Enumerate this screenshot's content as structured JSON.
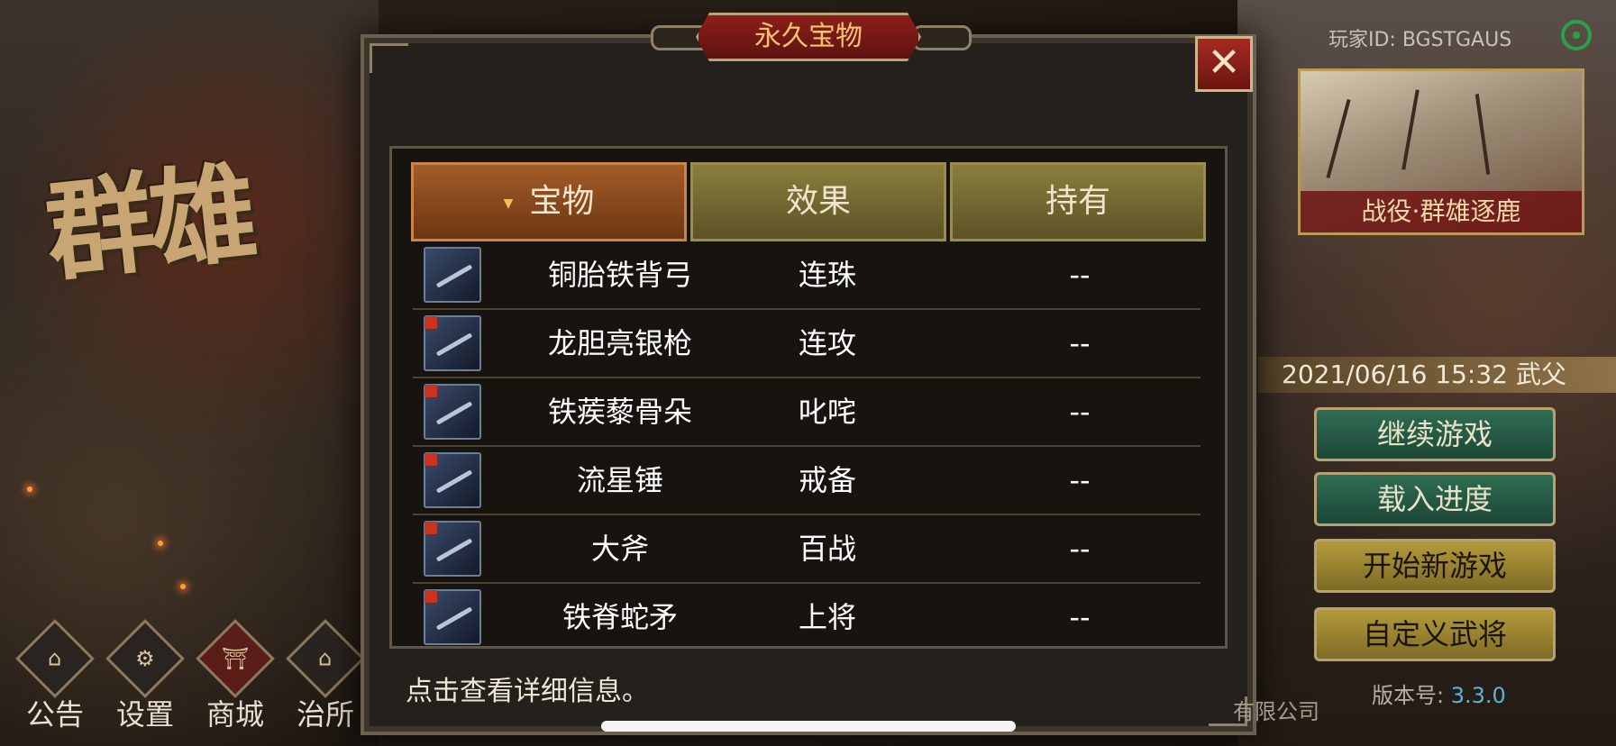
{
  "background": {
    "game_logo": "群雄",
    "player_id_label": "玩家ID:",
    "player_id_value": "BGSTGAUS",
    "campaign_title": "战役·群雄逐鹿",
    "datetime": "2021/06/16 15:32 武父",
    "menu": [
      {
        "label": "继续游戏",
        "style": "green"
      },
      {
        "label": "载入进度",
        "style": "green"
      },
      {
        "label": "开始新游戏",
        "style": "gold"
      },
      {
        "label": "自定义武将",
        "style": "gold"
      }
    ],
    "version_label": "版本号:",
    "version_value": "3.3.0",
    "company_fragment": "有限公司",
    "nav": [
      {
        "label": "公告",
        "icon": "announcement-icon"
      },
      {
        "label": "设置",
        "icon": "settings-gear-icon"
      },
      {
        "label": "商城",
        "icon": "shop-icon"
      },
      {
        "label": "治所",
        "icon": "palace-icon"
      }
    ]
  },
  "modal": {
    "title": "永久宝物",
    "close_symbol": "✕",
    "columns": {
      "treasure": "宝物",
      "effect": "效果",
      "owned": "持有"
    },
    "rows": [
      {
        "name": "铜胎铁背弓",
        "effect": "连珠",
        "owned": "--"
      },
      {
        "name": "龙胆亮银枪",
        "effect": "连攻",
        "owned": "--"
      },
      {
        "name": "铁蒺藜骨朵",
        "effect": "叱咤",
        "owned": "--"
      },
      {
        "name": "流星锤",
        "effect": "戒备",
        "owned": "--"
      },
      {
        "name": "大斧",
        "effect": "百战",
        "owned": "--"
      },
      {
        "name": "铁脊蛇矛",
        "effect": "上将",
        "owned": "--"
      }
    ],
    "hint": "点击查看详细信息。"
  },
  "colors": {
    "modal_bg": "#24201b",
    "active_header": "#a35b28",
    "normal_header": "#8a7d3d",
    "title_red": "#8e1f1a",
    "title_text": "#f5c56e",
    "version_blue": "#57b5d6",
    "green_button": "#2f6d52",
    "gold_button": "#b39a3b"
  }
}
